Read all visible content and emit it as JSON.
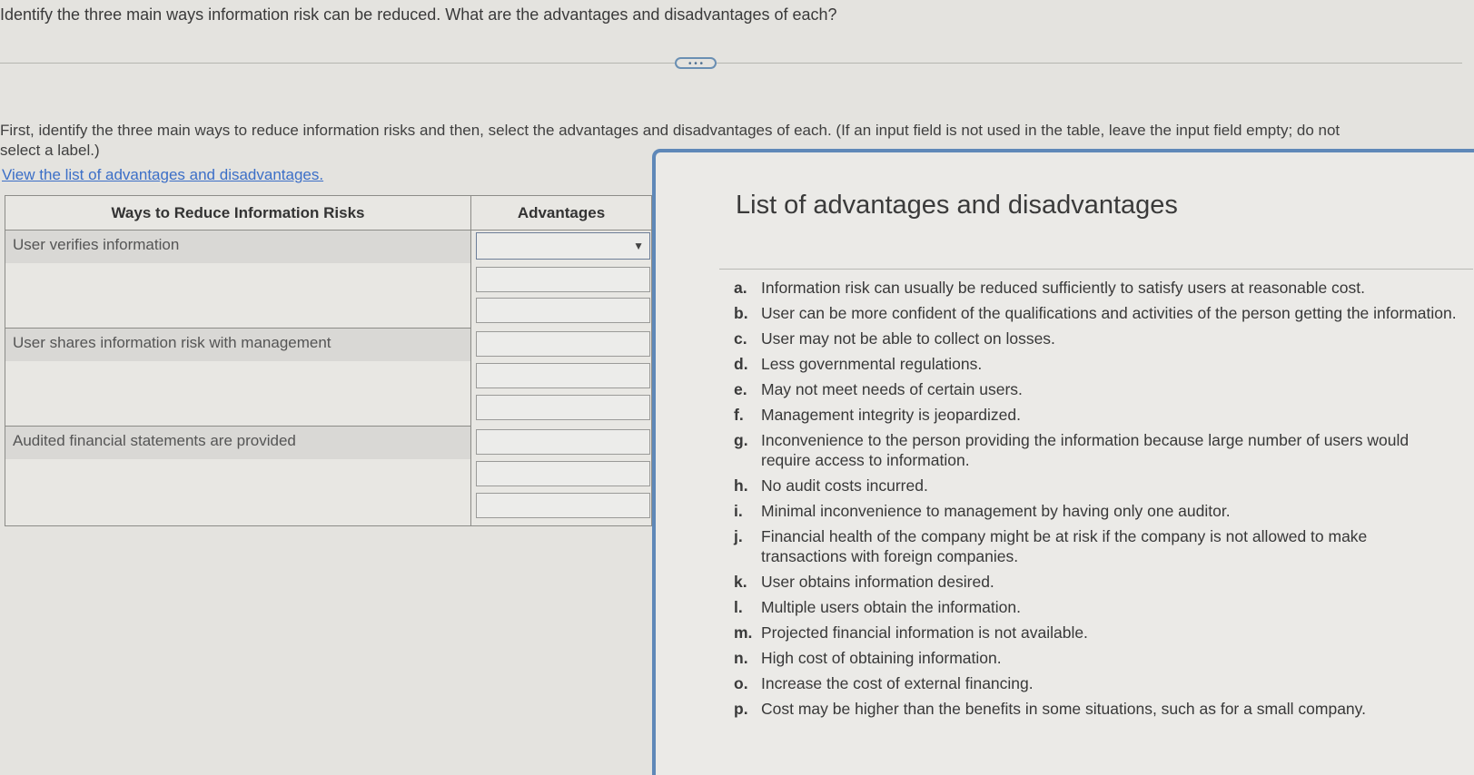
{
  "question": "Identify the three main ways information risk can be reduced. What are the advantages and disadvantages of each?",
  "expand_label": "• • •",
  "instructions": "First, identify the three main ways to reduce information risks and then, select the advantages and disadvantages of each. (If an input  field is not used in the table, leave the input field empty; do not select a label.)",
  "view_link": "View the list of advantages and disadvantages.",
  "table": {
    "col_ways": "Ways to Reduce Information Risks",
    "col_advantages": "Advantages",
    "rows": [
      {
        "label": "User verifies information"
      },
      {
        "label": "User shares information risk with management"
      },
      {
        "label": "Audited financial statements are provided"
      }
    ],
    "dropdown_arrow": "▼"
  },
  "popup": {
    "title": "List of advantages and disadvantages",
    "items": [
      {
        "letter": "a.",
        "text": "Information risk can usually be reduced sufficiently to satisfy users at reasonable cost."
      },
      {
        "letter": "b.",
        "text": "User can be more confident of the qualifications and activities of the person getting the information."
      },
      {
        "letter": "c.",
        "text": "User may not be able to collect on losses."
      },
      {
        "letter": "d.",
        "text": "Less governmental regulations."
      },
      {
        "letter": "e.",
        "text": "May not meet needs of certain users."
      },
      {
        "letter": "f.",
        "text": "Management integrity is jeopardized."
      },
      {
        "letter": "g.",
        "text": "Inconvenience to the person providing the information because large number of users would require access to information."
      },
      {
        "letter": "h.",
        "text": "No audit costs incurred."
      },
      {
        "letter": "i.",
        "text": "Minimal inconvenience to management by having only one auditor."
      },
      {
        "letter": "j.",
        "text": "Financial health of the company might be at risk if the company is not allowed to make transactions with foreign companies."
      },
      {
        "letter": "k.",
        "text": "User obtains information desired."
      },
      {
        "letter": "l.",
        "text": "Multiple users obtain the information."
      },
      {
        "letter": "m.",
        "text": "Projected financial information is not available."
      },
      {
        "letter": "n.",
        "text": "High cost of obtaining information."
      },
      {
        "letter": "o.",
        "text": "Increase the cost of external financing."
      },
      {
        "letter": "p.",
        "text": "Cost may be higher than the benefits in some situations, such as for a small company."
      }
    ]
  }
}
